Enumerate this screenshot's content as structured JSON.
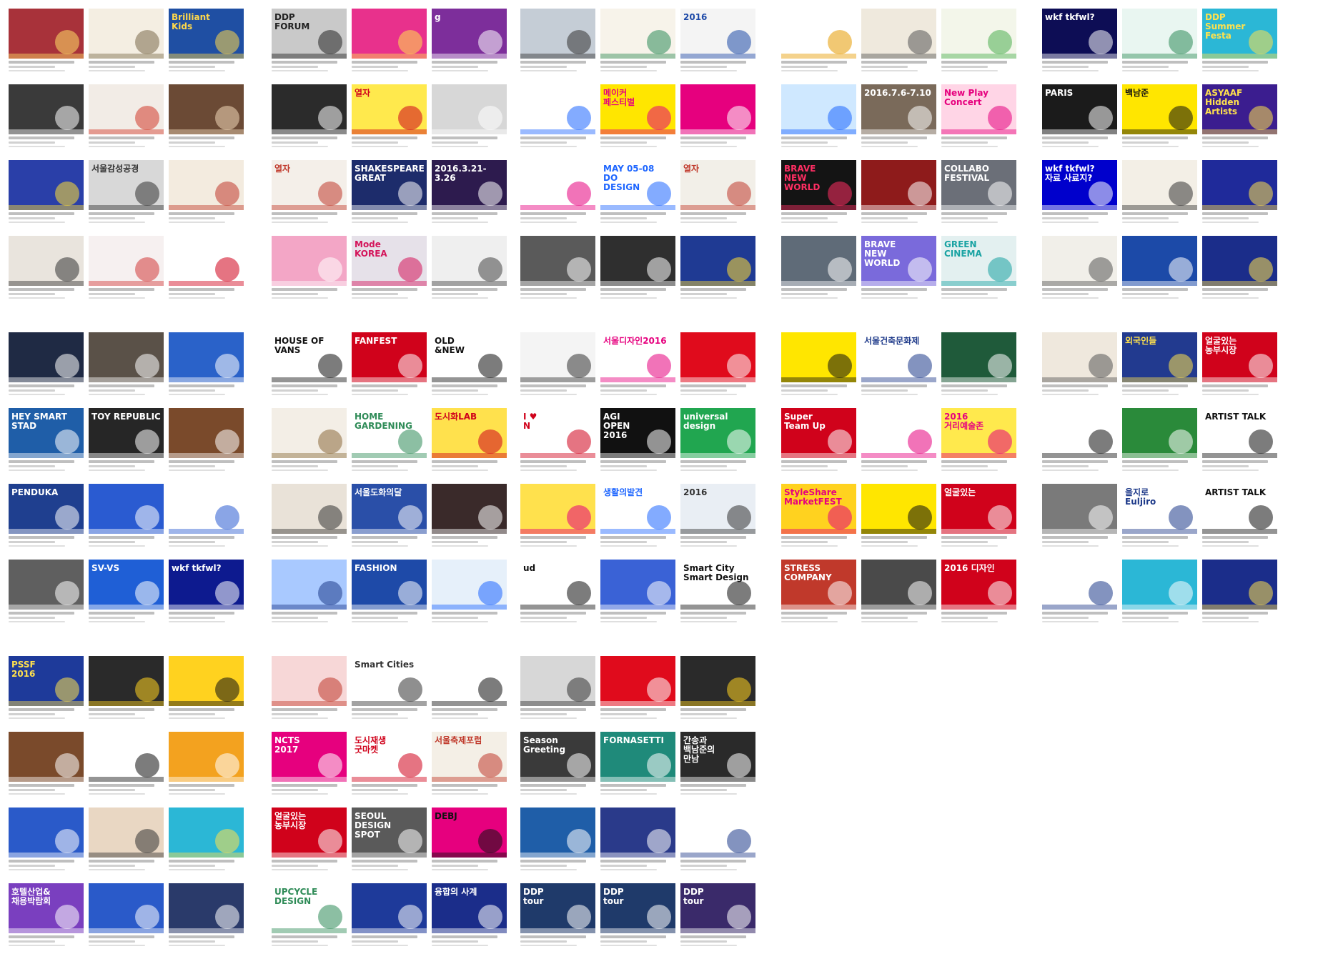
{
  "page": {
    "background": "#ffffff"
  },
  "blocks": [
    {
      "tiles": [
        {
          "bg": "#a8323a",
          "fg": "#ffe066",
          "text": ""
        },
        {
          "bg": "#f4eee2",
          "fg": "#7a6a4a",
          "text": ""
        },
        {
          "bg": "#1f4fa3",
          "fg": "#ffd84a",
          "text": "Brilliant\nKids"
        },
        {
          "bg": "#3a3a3a",
          "fg": "#ffffff",
          "text": ""
        },
        {
          "bg": "#f2ece6",
          "fg": "#d23a2a",
          "text": ""
        },
        {
          "bg": "#6b4a35",
          "fg": "#f2d9b8",
          "text": ""
        },
        {
          "bg": "#2a3fa8",
          "fg": "#ffe033",
          "text": ""
        },
        {
          "bg": "#d8d8d8",
          "fg": "#333333",
          "text": "서울감성공경"
        },
        {
          "bg": "#f3ebdf",
          "fg": "#c0392b",
          "text": ""
        },
        {
          "bg": "#e9e4dd",
          "fg": "#333333",
          "text": ""
        },
        {
          "bg": "#f6f0f0",
          "fg": "#d23a3a",
          "text": ""
        },
        {
          "bg": "#ffffff",
          "fg": "#d0021b",
          "text": ""
        }
      ]
    },
    {
      "tiles": [
        {
          "bg": "#c9c9c9",
          "fg": "#222222",
          "text": "DDP\nFORUM"
        },
        {
          "bg": "#e8318c",
          "fg": "#ffe14d",
          "text": ""
        },
        {
          "bg": "#7d2e9b",
          "fg": "#ffffff",
          "text": "g"
        },
        {
          "bg": "#2b2b2b",
          "fg": "#ffffff",
          "text": ""
        },
        {
          "bg": "#ffe94d",
          "fg": "#d0021b",
          "text": "열자"
        },
        {
          "bg": "#d7d7d7",
          "fg": "#ffffff",
          "text": ""
        },
        {
          "bg": "#f4efe9",
          "fg": "#c0392b",
          "text": "열자"
        },
        {
          "bg": "#1d2c6b",
          "fg": "#ffffff",
          "text": "SHAKESPEARE\nGREAT"
        },
        {
          "bg": "#2d1b4e",
          "fg": "#ffffff",
          "text": "2016.3.21-3.26"
        },
        {
          "bg": "#f3a6c6",
          "fg": "#ffffff",
          "text": ""
        },
        {
          "bg": "#e6e1e9",
          "fg": "#d4145a",
          "text": "Mode\nKOREA"
        },
        {
          "bg": "#efefef",
          "fg": "#444444",
          "text": ""
        }
      ]
    },
    {
      "tiles": [
        {
          "bg": "#c5cdd6",
          "fg": "#333333",
          "text": ""
        },
        {
          "bg": "#f7f3ea",
          "fg": "#2e8b57",
          "text": ""
        },
        {
          "bg": "#f4f4f4",
          "fg": "#1e4aa8",
          "text": "2016"
        },
        {
          "bg": "#ffffff",
          "fg": "#1e66ff",
          "text": ""
        },
        {
          "bg": "#ffe600",
          "fg": "#e5007e",
          "text": "메이커\n페스티벌"
        },
        {
          "bg": "#e6007e",
          "fg": "#ffffff",
          "text": ""
        },
        {
          "bg": "#ffffff",
          "fg": "#e6007e",
          "text": ""
        },
        {
          "bg": "#ffffff",
          "fg": "#1e66ff",
          "text": "MAY 05-08\nDO\nDESIGN"
        },
        {
          "bg": "#f2efe8",
          "fg": "#c0392b",
          "text": "열자"
        },
        {
          "bg": "#5a5a5a",
          "fg": "#ffffff",
          "text": ""
        },
        {
          "bg": "#2f2f2f",
          "fg": "#ffffff",
          "text": ""
        },
        {
          "bg": "#1f3a93",
          "fg": "#ffdd33",
          "text": ""
        }
      ]
    },
    {
      "tiles": [
        {
          "bg": "#ffffff",
          "fg": "#e69b00",
          "text": ""
        },
        {
          "bg": "#efe9dd",
          "fg": "#555555",
          "text": ""
        },
        {
          "bg": "#f3f6ea",
          "fg": "#4caf50",
          "text": ""
        },
        {
          "bg": "#cfe8ff",
          "fg": "#1e66ff",
          "text": ""
        },
        {
          "bg": "#7a6a5a",
          "fg": "#ffffff",
          "text": "2016.7.6-7.10"
        },
        {
          "bg": "#ffd5e6",
          "fg": "#e6007e",
          "text": "New Play\nConcert"
        },
        {
          "bg": "#141414",
          "fg": "#ff2e63",
          "text": "BRAVE\nNEW\nWORLD"
        },
        {
          "bg": "#8e1b1b",
          "fg": "#ffffff",
          "text": ""
        },
        {
          "bg": "#6b6f78",
          "fg": "#ffffff",
          "text": "COLLABO\nFESTIVAL"
        },
        {
          "bg": "#5f6b78",
          "fg": "#ffffff",
          "text": ""
        },
        {
          "bg": "#7a6adb",
          "fg": "#ffffff",
          "text": "BRAVE\nNEW\nWORLD"
        },
        {
          "bg": "#e3f0f0",
          "fg": "#1aa3a3",
          "text": "GREEN\nCINEMA"
        }
      ]
    },
    {
      "tiles": [
        {
          "bg": "#0d0d55",
          "fg": "#ffffff",
          "text": "wkf tkfwl?"
        },
        {
          "bg": "#e9f6f1",
          "fg": "#2e8b57",
          "text": ""
        },
        {
          "bg": "#2bb7d6",
          "fg": "#ffe14d",
          "text": "DDP\nSummer\nFesta"
        },
        {
          "bg": "#1b1b1b",
          "fg": "#ffffff",
          "text": "PARIS"
        },
        {
          "bg": "#ffe600",
          "fg": "#111111",
          "text": "백남준"
        },
        {
          "bg": "#3b1d8f",
          "fg": "#ffe14d",
          "text": "ASYAAF\nHidden\nArtists"
        },
        {
          "bg": "#0000cc",
          "fg": "#ffffff",
          "text": "wkf tkfwl?\n자료 사료지?"
        },
        {
          "bg": "#f3efe6",
          "fg": "#333333",
          "text": ""
        },
        {
          "bg": "#1f2a9a",
          "fg": "#ffe14d",
          "text": ""
        },
        {
          "bg": "#f1efe9",
          "fg": "#555555",
          "text": ""
        },
        {
          "bg": "#1c4aa8",
          "fg": "#ffffff",
          "text": ""
        },
        {
          "bg": "#1b2d8a",
          "fg": "#ffe14d",
          "text": ""
        }
      ]
    },
    {
      "tiles": [
        {
          "bg": "#1f2a44",
          "fg": "#ffffff",
          "text": ""
        },
        {
          "bg": "#5a5148",
          "fg": "#ffffff",
          "text": ""
        },
        {
          "bg": "#2a62c9",
          "fg": "#ffffff",
          "text": ""
        },
        {
          "bg": "#1f5ea8",
          "fg": "#ffffff",
          "text": "HEY SMART STAD"
        },
        {
          "bg": "#262626",
          "fg": "#ffffff",
          "text": "TOY REPUBLIC"
        },
        {
          "bg": "#7a4a2b",
          "fg": "#ffffff",
          "text": ""
        },
        {
          "bg": "#1f3f8f",
          "fg": "#ffffff",
          "text": "PENDUKA"
        },
        {
          "bg": "#2a5bd1",
          "fg": "#ffffff",
          "text": ""
        },
        {
          "bg": "#ffffff",
          "fg": "#2a5bd1",
          "text": ""
        },
        {
          "bg": "#5f5f5f",
          "fg": "#ffffff",
          "text": ""
        },
        {
          "bg": "#1f5fd6",
          "fg": "#ffffff",
          "text": "SV-VS"
        },
        {
          "bg": "#0d1a8f",
          "fg": "#ffffff",
          "text": "wkf tkfwl?"
        }
      ]
    },
    {
      "tiles": [
        {
          "bg": "#ffffff",
          "fg": "#111111",
          "text": "HOUSE OF\nVANS"
        },
        {
          "bg": "#d0021b",
          "fg": "#ffffff",
          "text": "FANFEST"
        },
        {
          "bg": "#ffffff",
          "fg": "#111111",
          "text": "OLD\n&NEW"
        },
        {
          "bg": "#f3eee6",
          "fg": "#8a6a3a",
          "text": ""
        },
        {
          "bg": "#ffffff",
          "fg": "#2e8b57",
          "text": "HOME GARDENING"
        },
        {
          "bg": "#ffe14d",
          "fg": "#d0021b",
          "text": "도시화LAB"
        },
        {
          "bg": "#e9e2d8",
          "fg": "#333333",
          "text": ""
        },
        {
          "bg": "#2a4fa8",
          "fg": "#ffffff",
          "text": "서울도화의달"
        },
        {
          "bg": "#3a2a2a",
          "fg": "#ffffff",
          "text": ""
        },
        {
          "bg": "#a9c9ff",
          "fg": "#1e3a8a",
          "text": ""
        },
        {
          "bg": "#1e4aa8",
          "fg": "#ffffff",
          "text": "FASHION"
        },
        {
          "bg": "#e6f0fa",
          "fg": "#1e66ff",
          "text": ""
        }
      ]
    },
    {
      "tiles": [
        {
          "bg": "#f4f4f4",
          "fg": "#333333",
          "text": ""
        },
        {
          "bg": "#ffffff",
          "fg": "#e6007e",
          "text": "서울디자인2016"
        },
        {
          "bg": "#e00b1c",
          "fg": "#ffffff",
          "text": ""
        },
        {
          "bg": "#ffffff",
          "fg": "#d0021b",
          "text": "I ♥\nN"
        },
        {
          "bg": "#111111",
          "fg": "#ffffff",
          "text": "AGI\nOPEN\n2016"
        },
        {
          "bg": "#21a650",
          "fg": "#ffffff",
          "text": "universal\ndesign"
        },
        {
          "bg": "#ffe14d",
          "fg": "#e6007e",
          "text": ""
        },
        {
          "bg": "#ffffff",
          "fg": "#1e66ff",
          "text": "생활의발견"
        },
        {
          "bg": "#e9eef4",
          "fg": "#333333",
          "text": "2016"
        },
        {
          "bg": "#ffffff",
          "fg": "#111111",
          "text": "ud"
        },
        {
          "bg": "#3a62d6",
          "fg": "#ffffff",
          "text": ""
        },
        {
          "bg": "#ffffff",
          "fg": "#111111",
          "text": "Smart City\nSmart Design"
        }
      ]
    },
    {
      "tiles": [
        {
          "bg": "#ffe600",
          "fg": "#111111",
          "text": ""
        },
        {
          "bg": "#ffffff",
          "fg": "#1e3a8a",
          "text": "서울건축문화제"
        },
        {
          "bg": "#1f5a3a",
          "fg": "#ffffff",
          "text": ""
        },
        {
          "bg": "#d0021b",
          "fg": "#ffffff",
          "text": "Super\nTeam Up"
        },
        {
          "bg": "#ffffff",
          "fg": "#e6007e",
          "text": ""
        },
        {
          "bg": "#ffe94d",
          "fg": "#e6007e",
          "text": "2016\n거리예술존"
        },
        {
          "bg": "#ffd21f",
          "fg": "#e6007e",
          "text": "StyleShare\nMarketFEST"
        },
        {
          "bg": "#ffe600",
          "fg": "#111111",
          "text": ""
        },
        {
          "bg": "#d0021b",
          "fg": "#ffffff",
          "text": "얼굴있는"
        },
        {
          "bg": "#c0392b",
          "fg": "#ffffff",
          "text": "STRESS COMPANY"
        },
        {
          "bg": "#4a4a4a",
          "fg": "#ffffff",
          "text": ""
        },
        {
          "bg": "#d0021b",
          "fg": "#ffffff",
          "text": "2016 디자인"
        }
      ]
    },
    {
      "tiles": [
        {
          "bg": "#efe8dd",
          "fg": "#555555",
          "text": ""
        },
        {
          "bg": "#223a8f",
          "fg": "#ffe14d",
          "text": "외국인들"
        },
        {
          "bg": "#d0021b",
          "fg": "#ffffff",
          "text": "얼굴있는\n농부시장"
        },
        {
          "bg": "#ffffff",
          "fg": "#111111",
          "text": ""
        },
        {
          "bg": "#2a8a3a",
          "fg": "#ffffff",
          "text": ""
        },
        {
          "bg": "#ffffff",
          "fg": "#111111",
          "text": "ARTIST TALK"
        },
        {
          "bg": "#7a7a7a",
          "fg": "#ffffff",
          "text": ""
        },
        {
          "bg": "#ffffff",
          "fg": "#1e3a8a",
          "text": "을지로\nEuljiro"
        },
        {
          "bg": "#ffffff",
          "fg": "#111111",
          "text": "ARTIST TALK"
        },
        {
          "bg": "#ffffff",
          "fg": "#1e3a8a",
          "text": ""
        },
        {
          "bg": "#2bb7d6",
          "fg": "#ffffff",
          "text": ""
        },
        {
          "bg": "#1b2d8a",
          "fg": "#ffe14d",
          "text": ""
        }
      ]
    },
    {
      "tiles": [
        {
          "bg": "#1e3a9a",
          "fg": "#ffe14d",
          "text": "PSSF\n2016"
        },
        {
          "bg": "#2a2a2a",
          "fg": "#ffd21f",
          "text": ""
        },
        {
          "bg": "#ffd21f",
          "fg": "#111111",
          "text": ""
        },
        {
          "bg": "#7a4a2b",
          "fg": "#ffffff",
          "text": ""
        },
        {
          "bg": "#ffffff",
          "fg": "#111111",
          "text": ""
        },
        {
          "bg": "#f3a21f",
          "fg": "#ffffff",
          "text": ""
        },
        {
          "bg": "#2a5ac9",
          "fg": "#ffffff",
          "text": ""
        },
        {
          "bg": "#e9d7c3",
          "fg": "#333333",
          "text": ""
        },
        {
          "bg": "#2bb7d6",
          "fg": "#ffe14d",
          "text": ""
        },
        {
          "bg": "#7a3fbf",
          "fg": "#ffffff",
          "text": "호텔산업&\n채용박람회"
        },
        {
          "bg": "#2a5ac9",
          "fg": "#ffffff",
          "text": ""
        },
        {
          "bg": "#2a3a6a",
          "fg": "#ffffff",
          "text": ""
        }
      ]
    },
    {
      "tiles": [
        {
          "bg": "#f7d7d7",
          "fg": "#c0392b",
          "text": ""
        },
        {
          "bg": "#ffffff",
          "fg": "#333333",
          "text": "Smart Cities"
        },
        {
          "bg": "#ffffff",
          "fg": "#111111",
          "text": ""
        },
        {
          "bg": "#e6007e",
          "fg": "#ffffff",
          "text": "NCTS\n2017"
        },
        {
          "bg": "#ffffff",
          "fg": "#d0021b",
          "text": "도시재생\n굿마켓"
        },
        {
          "bg": "#f4efe6",
          "fg": "#c0392b",
          "text": "서울축제포럼"
        },
        {
          "bg": "#d0021b",
          "fg": "#ffffff",
          "text": "얼굴있는\n농부시장"
        },
        {
          "bg": "#5a5a5a",
          "fg": "#ffffff",
          "text": "SEOUL\nDESIGN\nSPOT"
        },
        {
          "bg": "#e6007e",
          "fg": "#111111",
          "text": "DEBJ"
        },
        {
          "bg": "#ffffff",
          "fg": "#2e8b57",
          "text": "UPCYCLE\nDESIGN"
        },
        {
          "bg": "#1e3a9a",
          "fg": "#ffffff",
          "text": ""
        },
        {
          "bg": "#1b2d8a",
          "fg": "#ffffff",
          "text": "융합의 사계"
        }
      ]
    },
    {
      "tiles": [
        {
          "bg": "#d7d7d7",
          "fg": "#333333",
          "text": ""
        },
        {
          "bg": "#e00b1c",
          "fg": "#ffffff",
          "text": ""
        },
        {
          "bg": "#2a2a2a",
          "fg": "#ffd21f",
          "text": ""
        },
        {
          "bg": "#3a3a3a",
          "fg": "#ffffff",
          "text": "Season Greeting"
        },
        {
          "bg": "#1f8a7a",
          "fg": "#ffffff",
          "text": "FORNASETTI"
        },
        {
          "bg": "#2a2a2a",
          "fg": "#ffffff",
          "text": "간송과\n백남준의\n만남"
        },
        {
          "bg": "#1f5ea8",
          "fg": "#ffffff",
          "text": ""
        },
        {
          "bg": "#2a3a8a",
          "fg": "#ffffff",
          "text": ""
        },
        {
          "bg": "#ffffff",
          "fg": "#1e3a8a",
          "text": ""
        },
        {
          "bg": "#1f3a6a",
          "fg": "#ffffff",
          "text": "DDP\ntour"
        },
        {
          "bg": "#1f3a6a",
          "fg": "#ffffff",
          "text": "DDP\ntour"
        },
        {
          "bg": "#3a2a6a",
          "fg": "#ffffff",
          "text": "DDP\ntour"
        }
      ]
    }
  ]
}
